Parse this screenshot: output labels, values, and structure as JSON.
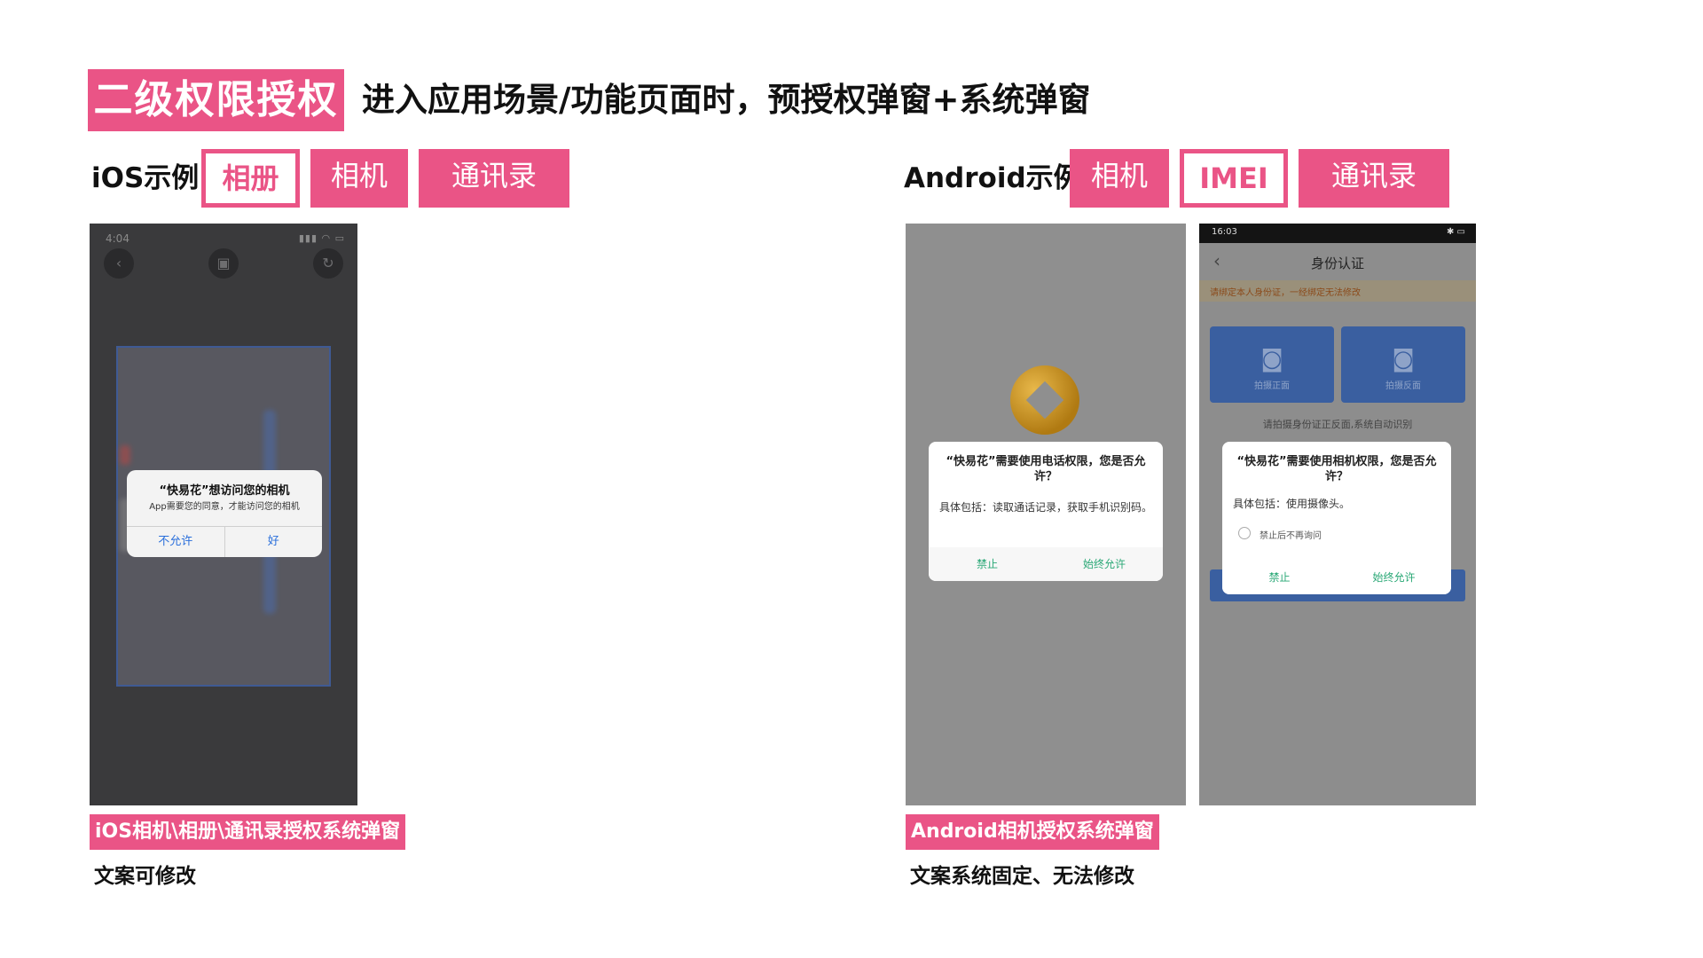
{
  "header": {
    "badge": "二级权限授权",
    "subtitle": "进入应用场景/功能页面时，预授权弹窗+系统弹窗"
  },
  "ios": {
    "label": "iOS示例",
    "tags": [
      "相册",
      "相机",
      "通讯录"
    ],
    "screen": {
      "time": "4:04",
      "alert_title": "“快易花”想访问您的相机",
      "alert_message": "App需要您的同意，才能访问您的相机",
      "deny": "不允许",
      "ok": "好"
    },
    "caption": "iOS相机\\相册\\通讯录授权系统弹窗",
    "note": "文案可修改"
  },
  "android": {
    "label": "Android示例",
    "tags": [
      "相机",
      "IMEI",
      "通讯录"
    ],
    "phone_dialog": {
      "title": "“快易花”需要使用电话权限，您是否允许？",
      "body": "具体包括：读取通话记录，获取手机识别码。",
      "deny": "禁止",
      "allow": "始终允许"
    },
    "id_screen": {
      "time": "16:03",
      "title": "身份认证",
      "notice": "请绑定本人身份证，一经绑定无法修改",
      "front": "拍摄正面",
      "back": "拍摄反面",
      "hint": "请拍摄身份证正反面,系统自动识别"
    },
    "camera_dialog": {
      "title": "“快易花”需要使用相机权限，您是否允许？",
      "body": "具体包括：使用摄像头。",
      "checkbox": "禁止后不再询问",
      "deny": "禁止",
      "allow": "始终允许"
    },
    "caption": "Android相机授权系统弹窗",
    "note": "文案系统固定、无法修改"
  },
  "colors": {
    "accent": "#ea5486",
    "android_button": "#2aa876",
    "ios_button": "#2a6fdb"
  },
  "icons": [
    "back-chevron-icon",
    "camera-icon",
    "app-logo-icon"
  ]
}
